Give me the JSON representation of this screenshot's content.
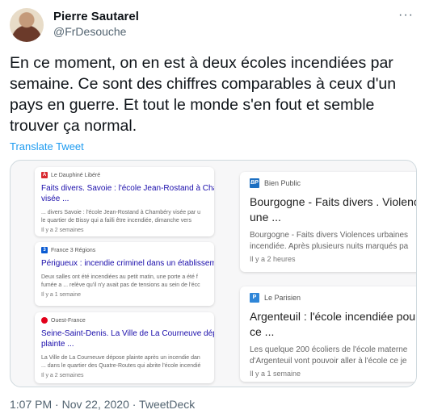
{
  "author": {
    "name": "Pierre Sautarel",
    "handle": "@FrDesouche"
  },
  "more_icon": "···",
  "tweet": {
    "text": "En ce moment, on en est à deux écoles incendiées par semaine. Ce sont des chiffres comparables à ceux d'un pays en guerre. Et tout le monde s'en fout et semble trouver ça normal.",
    "translate_label": "Translate Tweet",
    "timestamp": "1:07 PM · Nov 22, 2020 · TweetDeck"
  },
  "colors": {
    "link": "#1d9bf0",
    "muted": "#536471",
    "dauphine_logo": "#d9282f",
    "france3_logo": "#0a5bd3",
    "ouest_france_logo": "#e2001a",
    "bien_public_logo": "#1c6fc2",
    "le_parisien_logo": "#2f86d8"
  },
  "news_cards": [
    {
      "source": "Le Dauphiné Libéré",
      "logo_icon": "dauphine-logo-icon",
      "logo_text": "A",
      "title_line1": "Faits divers. Savoie : l'école Jean-Rostand à Cha",
      "title_line2": "visée ...",
      "snippet_line1": "... divers Savoie : l'école Jean-Rostand à Chambéry visée par u",
      "snippet_line2": "le quartier de Bissy qui a failli être incendiée, dimanche vers",
      "time": "Il y a 2 semaines"
    },
    {
      "source": "France 3 Régions",
      "logo_icon": "france3-logo-icon",
      "logo_text": "3",
      "title_line1": "Périgueux : incendie criminel dans un établisseme",
      "title_line2": "",
      "snippet_line1": "Deux salles ont été incendiées au petit matin, une porte a été f",
      "snippet_line2": "fumée a ... relève qu'il n'y avait pas de tensions au sein de l'écc",
      "time": "Il y a 1 semaine"
    },
    {
      "source": "Ouest-France",
      "logo_icon": "ouest-france-logo-icon",
      "logo_text": "",
      "title_line1": "Seine-Saint-Denis. La Ville de La Courneuve dép",
      "title_line2": "plainte ...",
      "snippet_line1": "La Ville de La Courneuve dépose plainte après un incendie dan",
      "snippet_line2": "... dans le quartier des Quatre-Routes qui abrite l'école incendié",
      "time": "Il y a 2 semaines"
    },
    {
      "source": "Bien Public",
      "logo_icon": "bien-public-logo-icon",
      "logo_text": "BP",
      "title_line1": "Bourgogne - Faits divers . Violence",
      "title_line2": "une ...",
      "snippet_line1": "Bourgogne - Faits divers Violences urbaines",
      "snippet_line2": "incendiée. Après plusieurs nuits marqués pa",
      "time": "Il y a 2 heures"
    },
    {
      "source": "Le Parisien",
      "logo_icon": "le-parisien-logo-icon",
      "logo_text": "P",
      "title_line1": "Argenteuil : l'école incendiée pour",
      "title_line2": "ce ...",
      "snippet_line1": "Les quelque 200 écoliers de l'école materne",
      "snippet_line2": "d'Argenteuil vont pouvoir aller à l'école ce je",
      "time": "Il y a 1 semaine"
    }
  ]
}
